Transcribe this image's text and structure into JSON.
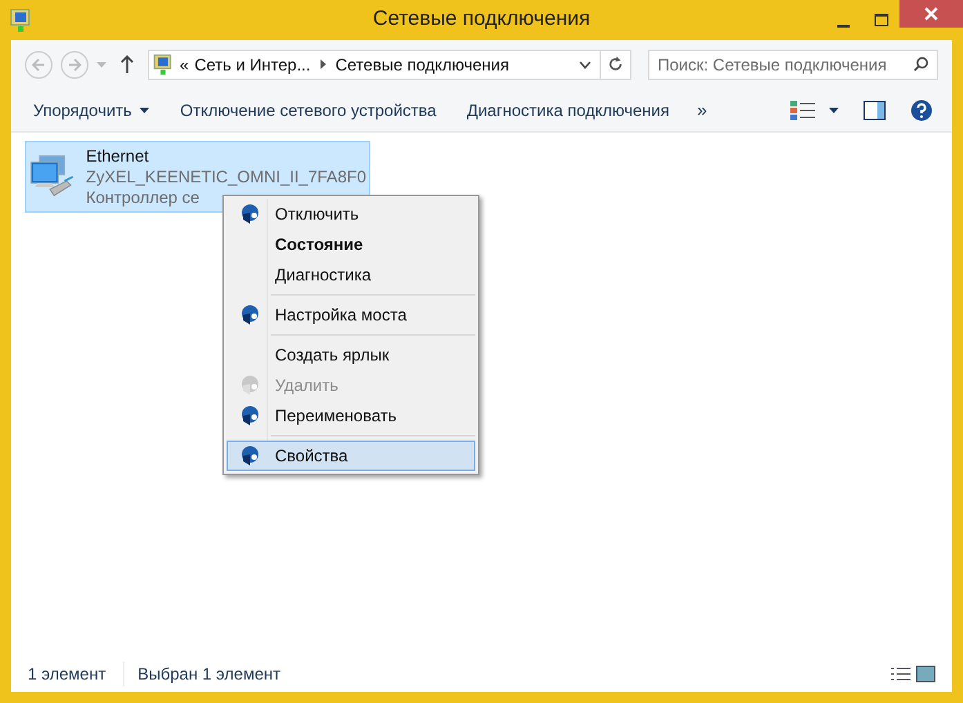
{
  "window": {
    "title": "Сетевые подключения"
  },
  "address_bar": {
    "overflow": "«",
    "crumbs": [
      "Сеть и Интер...",
      "Сетевые подключения"
    ]
  },
  "search": {
    "placeholder": "Поиск: Сетевые подключения"
  },
  "toolbar": {
    "items": [
      {
        "label": "Упорядочить",
        "dropdown": true
      },
      {
        "label": "Отключение сетевого устройства",
        "dropdown": false
      },
      {
        "label": "Диагностика подключения",
        "dropdown": false
      }
    ],
    "more": "»"
  },
  "connections": [
    {
      "name": "Ethernet",
      "network": "ZyXEL_KEENETIC_OMNI_II_7FA8F0",
      "adapter": "Контроллер се",
      "selected": true
    }
  ],
  "context_menu": [
    {
      "kind": "item",
      "label": "Отключить",
      "icon": true,
      "default": false,
      "disabled": false,
      "selected": false
    },
    {
      "kind": "item",
      "label": "Состояние",
      "icon": false,
      "default": true,
      "disabled": false,
      "selected": false
    },
    {
      "kind": "item",
      "label": "Диагностика",
      "icon": false,
      "default": false,
      "disabled": false,
      "selected": false
    },
    {
      "kind": "separator"
    },
    {
      "kind": "item",
      "label": "Настройка моста",
      "icon": true,
      "default": false,
      "disabled": false,
      "selected": false
    },
    {
      "kind": "separator"
    },
    {
      "kind": "item",
      "label": "Создать ярлык",
      "icon": false,
      "default": false,
      "disabled": false,
      "selected": false
    },
    {
      "kind": "item",
      "label": "Удалить",
      "icon": true,
      "default": false,
      "disabled": true,
      "selected": false
    },
    {
      "kind": "item",
      "label": "Переименовать",
      "icon": true,
      "default": false,
      "disabled": false,
      "selected": false
    },
    {
      "kind": "separator"
    },
    {
      "kind": "item",
      "label": "Свойства",
      "icon": true,
      "default": false,
      "disabled": false,
      "selected": true
    }
  ],
  "status_bar": [
    "1 элемент",
    "Выбран 1 элемент"
  ]
}
